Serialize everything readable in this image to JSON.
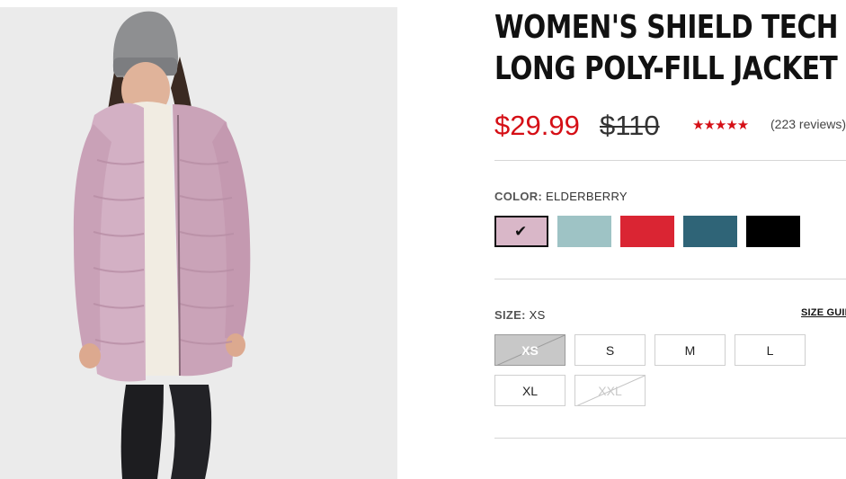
{
  "product": {
    "title_line1": "WOMEN'S SHIELD TECH",
    "title_line2": "LONG POLY-FILL JACKET",
    "sale_price": "$29.99",
    "original_price": "$110",
    "rating_stars": "★★★★★",
    "review_count": "(223 reviews)"
  },
  "color": {
    "label": "COLOR:",
    "selected_name": "ELDERBERRY",
    "swatches": [
      {
        "color": "#d9b7c8",
        "selected": true
      },
      {
        "color": "#9ec3c5",
        "selected": false
      },
      {
        "color": "#da2533",
        "selected": false
      },
      {
        "color": "#2f6477",
        "selected": false
      },
      {
        "color": "#000000",
        "selected": false
      }
    ],
    "check_icon": "check-icon"
  },
  "size": {
    "label": "SIZE:",
    "selected_name": "XS",
    "guide_link": "SIZE GUIDE",
    "options": [
      {
        "label": "XS",
        "state": "selected-unavailable"
      },
      {
        "label": "S",
        "state": "available"
      },
      {
        "label": "M",
        "state": "available"
      },
      {
        "label": "L",
        "state": "available"
      },
      {
        "label": "XL",
        "state": "available"
      },
      {
        "label": "XXL",
        "state": "unavailable"
      }
    ]
  },
  "colors": {
    "sale": "#d50f16",
    "text": "#111111",
    "image_background": "#ebebeb"
  }
}
